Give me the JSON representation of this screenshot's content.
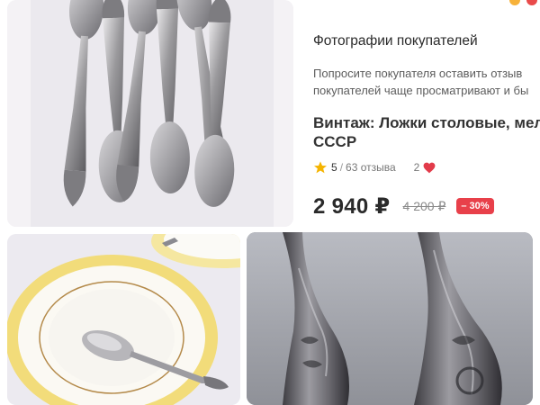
{
  "buyer_photos": {
    "title": "Фотографии покупателей",
    "hint_line_1": "Попросите покупателя оставить отзыв",
    "hint_line_2": "покупателей чаще просматривают и бы"
  },
  "product": {
    "title_line_1": "Винтаж: Ложки столовые, мел",
    "title_line_2": "СССР",
    "rating": "5",
    "reviews": "63 отзыва",
    "rating_separator": "/",
    "likes": "2",
    "price": "2 940 ₽",
    "old_price": "4 200 ₽",
    "discount": "– 30%"
  },
  "photos": [
    {
      "name": "photo-spoons-set",
      "subject": "six vintage silver spoons"
    },
    {
      "name": "photo-spoon-on-plate",
      "subject": "spoon on yellow-rimmed plate"
    },
    {
      "name": "photo-handles-closeup",
      "subject": "engraved spoon handles close-up"
    }
  ],
  "colors": {
    "accent_star": "#f5b400",
    "heart": "#e23b4a",
    "discount_badge": "#e8404a",
    "dot_yellow": "#f7b23a",
    "dot_red": "#e94a4a"
  },
  "icons": [
    "star-icon",
    "heart-icon"
  ]
}
